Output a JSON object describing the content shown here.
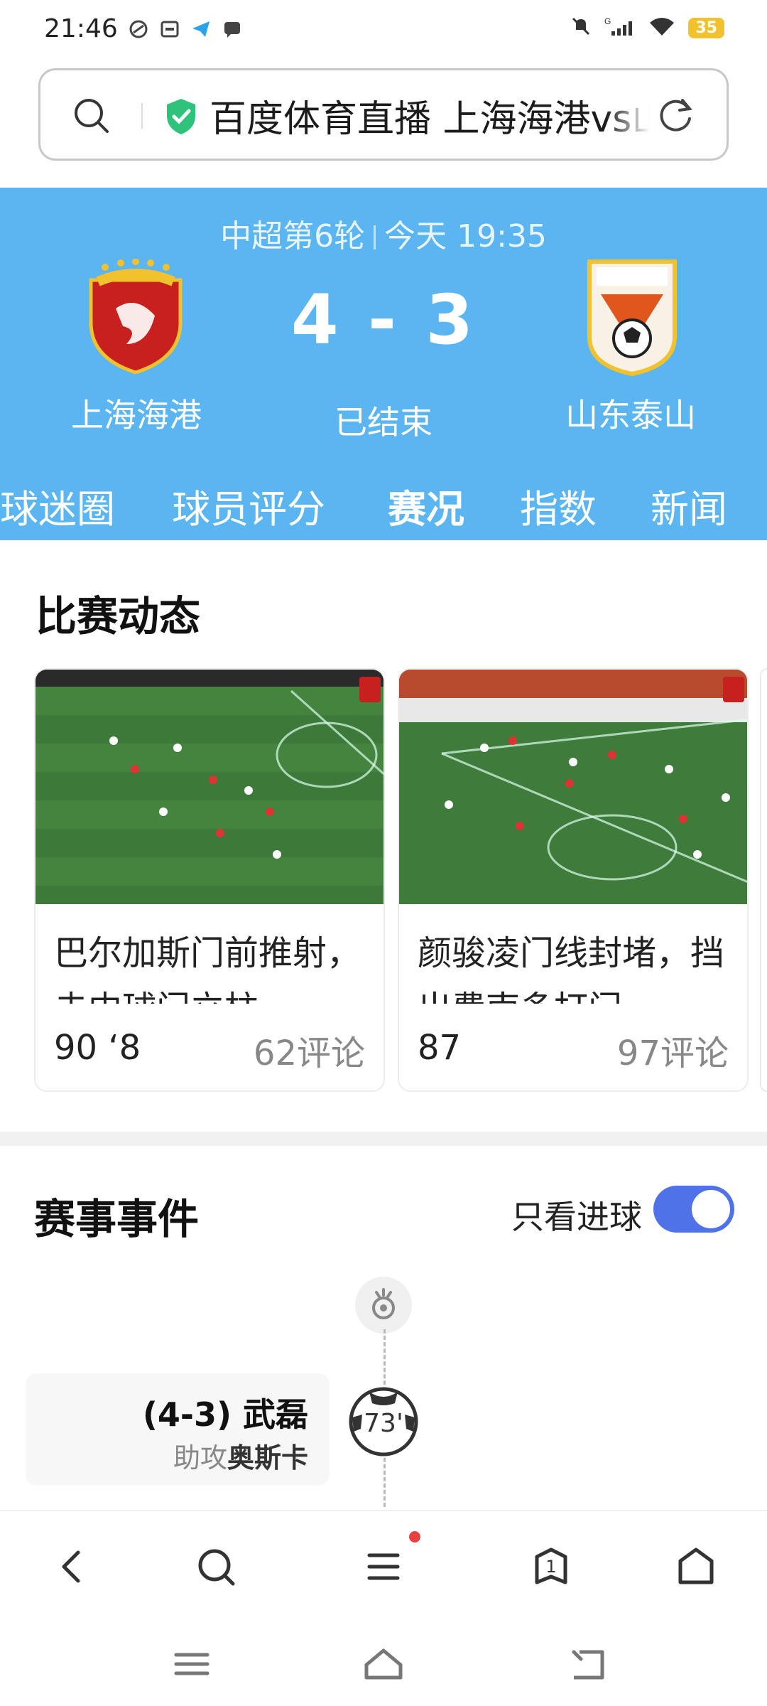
{
  "status_bar": {
    "time": "21:46",
    "battery": "35",
    "network": "G"
  },
  "address_bar": {
    "text": "百度体育直播 上海海港vs山东泰山"
  },
  "match": {
    "meta_round": "中超第6轮",
    "meta_time": "今天 19:35",
    "home_team": "上海海港",
    "away_team": "山东泰山",
    "score": "4 - 3",
    "status": "已结束"
  },
  "tabs": [
    {
      "label": "球迷圈"
    },
    {
      "label": "球员评分"
    },
    {
      "label": "赛况"
    },
    {
      "label": "指数"
    },
    {
      "label": "新闻"
    }
  ],
  "highlights": {
    "title": "比赛动态",
    "cards": [
      {
        "description": "巴尔加斯门前推射，击中球门立柱",
        "views": "90 ‘8",
        "comments": "62评论"
      },
      {
        "description": "颜骏凌门线封堵，挡出费南多打门",
        "views": "87",
        "comments": "97评论"
      }
    ]
  },
  "events": {
    "title": "赛事事件",
    "only_goals_label": "只看进球",
    "only_goals_on": true,
    "items": [
      {
        "score": "(4-3) 武磊",
        "assist_prefix": "助攻",
        "assist_player": "奥斯卡",
        "minute": "73'"
      }
    ]
  },
  "colors": {
    "header_bg": "#5ab5f0",
    "toggle_on": "#4f72e8",
    "notification_dot": "#e94040"
  }
}
